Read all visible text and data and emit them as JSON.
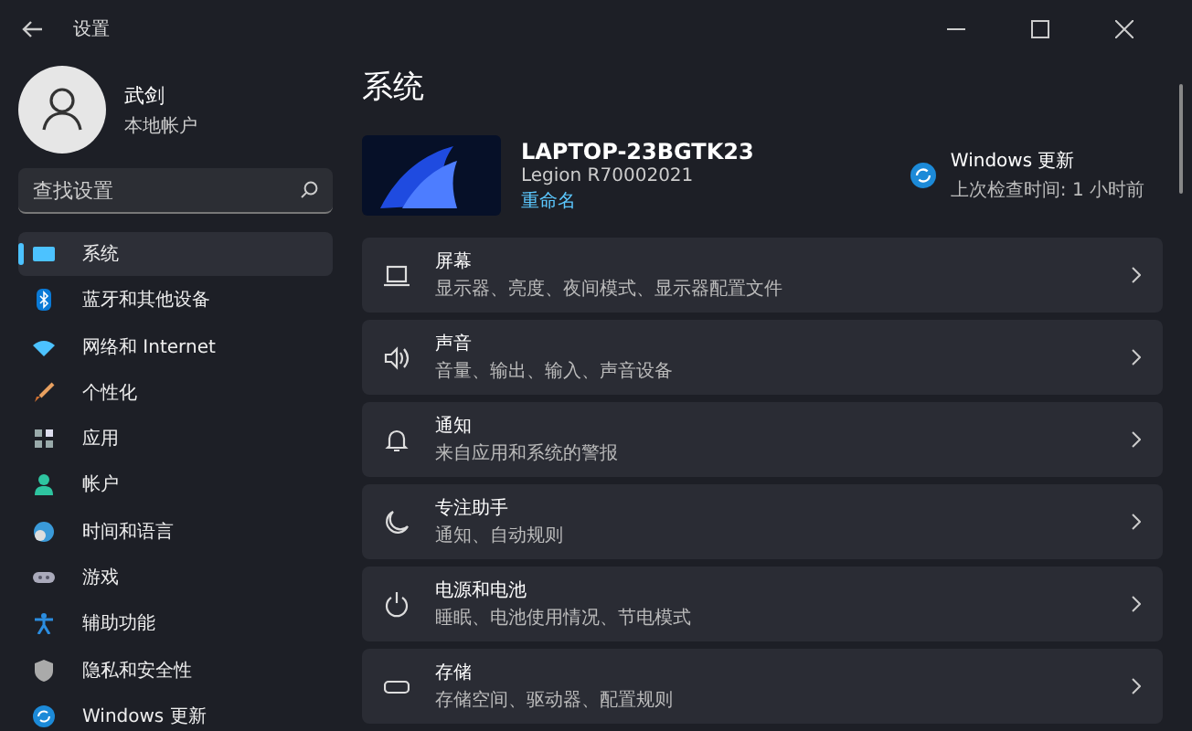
{
  "window": {
    "title": "设置"
  },
  "account": {
    "name": "武剑",
    "type": "本地帐户"
  },
  "search": {
    "placeholder": "查找设置"
  },
  "sidebar": {
    "items": [
      {
        "label": "系统",
        "selected": true
      },
      {
        "label": "蓝牙和其他设备",
        "selected": false
      },
      {
        "label": "网络和 Internet",
        "selected": false
      },
      {
        "label": "个性化",
        "selected": false
      },
      {
        "label": "应用",
        "selected": false
      },
      {
        "label": "帐户",
        "selected": false
      },
      {
        "label": "时间和语言",
        "selected": false
      },
      {
        "label": "游戏",
        "selected": false
      },
      {
        "label": "辅助功能",
        "selected": false
      },
      {
        "label": "隐私和安全性",
        "selected": false
      },
      {
        "label": "Windows 更新",
        "selected": false
      }
    ]
  },
  "page_title": "系统",
  "device": {
    "name": "LAPTOP-23BGTK23",
    "model": "Legion R70002021",
    "rename": "重命名"
  },
  "update": {
    "title": "Windows 更新",
    "status": "上次检查时间: 1 小时前"
  },
  "cards": [
    {
      "title": "屏幕",
      "subtitle": "显示器、亮度、夜间模式、显示器配置文件"
    },
    {
      "title": "声音",
      "subtitle": "音量、输出、输入、声音设备"
    },
    {
      "title": "通知",
      "subtitle": "来自应用和系统的警报"
    },
    {
      "title": "专注助手",
      "subtitle": "通知、自动规则"
    },
    {
      "title": "电源和电池",
      "subtitle": "睡眠、电池使用情况、节电模式"
    },
    {
      "title": "存储",
      "subtitle": "存储空间、驱动器、配置规则"
    }
  ]
}
